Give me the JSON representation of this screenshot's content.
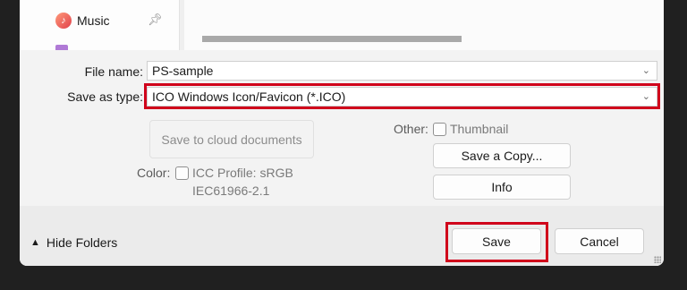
{
  "nav": {
    "music_label": "Music",
    "music_icon": "music-note-icon",
    "pin_icon": "pin-icon"
  },
  "form": {
    "file_name_label": "File name:",
    "file_name_value": "PS-sample",
    "save_type_label": "Save as type:",
    "save_type_value": "ICO Windows Icon/Favicon (*.ICO)"
  },
  "options": {
    "cloud_button": "Save to cloud documents",
    "color_label": "Color:",
    "icc_profile": "ICC Profile:  sRGB",
    "icc_profile_line2": "IEC61966-2.1",
    "other_label": "Other:",
    "thumbnail_label": "Thumbnail",
    "save_copy_button": "Save a Copy...",
    "info_button": "Info"
  },
  "footer": {
    "hide_folders": "Hide Folders",
    "save_button": "Save",
    "cancel_button": "Cancel"
  },
  "colors": {
    "highlight": "#d0021b",
    "background": "#202020",
    "dialog": "#f3f3f3"
  }
}
